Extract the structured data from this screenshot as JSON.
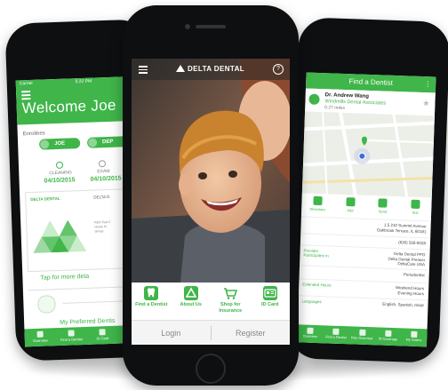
{
  "left_phone": {
    "status": {
      "carrier": "Carrier",
      "time": "5:22 PM"
    },
    "welcome": "Welcome Joe",
    "enrollees_label": "Enrollees",
    "pills": [
      "JOE",
      "DEP"
    ],
    "cleaning_label": "CLEANING",
    "cleaning_date": "04/10/2015",
    "exam_label": "EXAM",
    "exam_date": "04/10/2015",
    "card_logo": "DELTA DENTAL",
    "card_delta": "DELTA D",
    "card_lines": [
      "ROY Test C",
      "Home In",
      "Group"
    ],
    "tap_text": "Tap for more deta",
    "pref_dentist": "My Preferred Dentis",
    "tabs": [
      "Overview",
      "Find a Dentist",
      "ID Card",
      "Coverage"
    ]
  },
  "center_phone": {
    "brand": "DELTA DENTAL",
    "help": "?",
    "menu": [
      {
        "label": "Find a Dentist"
      },
      {
        "label": "About Us"
      },
      {
        "label": "Shop for Insurance"
      },
      {
        "label": "ID Card"
      }
    ],
    "login": "Login",
    "register": "Register"
  },
  "right_phone": {
    "header": "Find a Dentist",
    "doctor_name": "Dr. Andrew Wang",
    "practice": "Windmills Dental Associates",
    "distance": "0.27 miles",
    "actions": [
      "Directions",
      "Add",
      "Send",
      "Text"
    ],
    "rows": [
      {
        "key": "",
        "value": "1.5 210 Summit Avenue\nOakbrook Terrace, IL 60181"
      },
      {
        "key": "",
        "value": "(630) 556-6028"
      },
      {
        "key": "Provider\nParticipates in",
        "value": "Delta Dental PPO\nDelta Dental Premier\nDeltaCare USA"
      },
      {
        "key": "",
        "value": "Periodontist"
      },
      {
        "key": "Extended Hours",
        "value": "Weekend Hours\nEvening Hours"
      },
      {
        "key": "Languages",
        "value": "English, Spanish, Hindi"
      }
    ],
    "tabs": [
      "Overview",
      "Find a Dentist",
      "Plan Overview",
      "ID Coverage",
      "My Claims"
    ]
  },
  "colors": {
    "accent": "#3fb54a",
    "phone_body": "#0d0f10"
  }
}
